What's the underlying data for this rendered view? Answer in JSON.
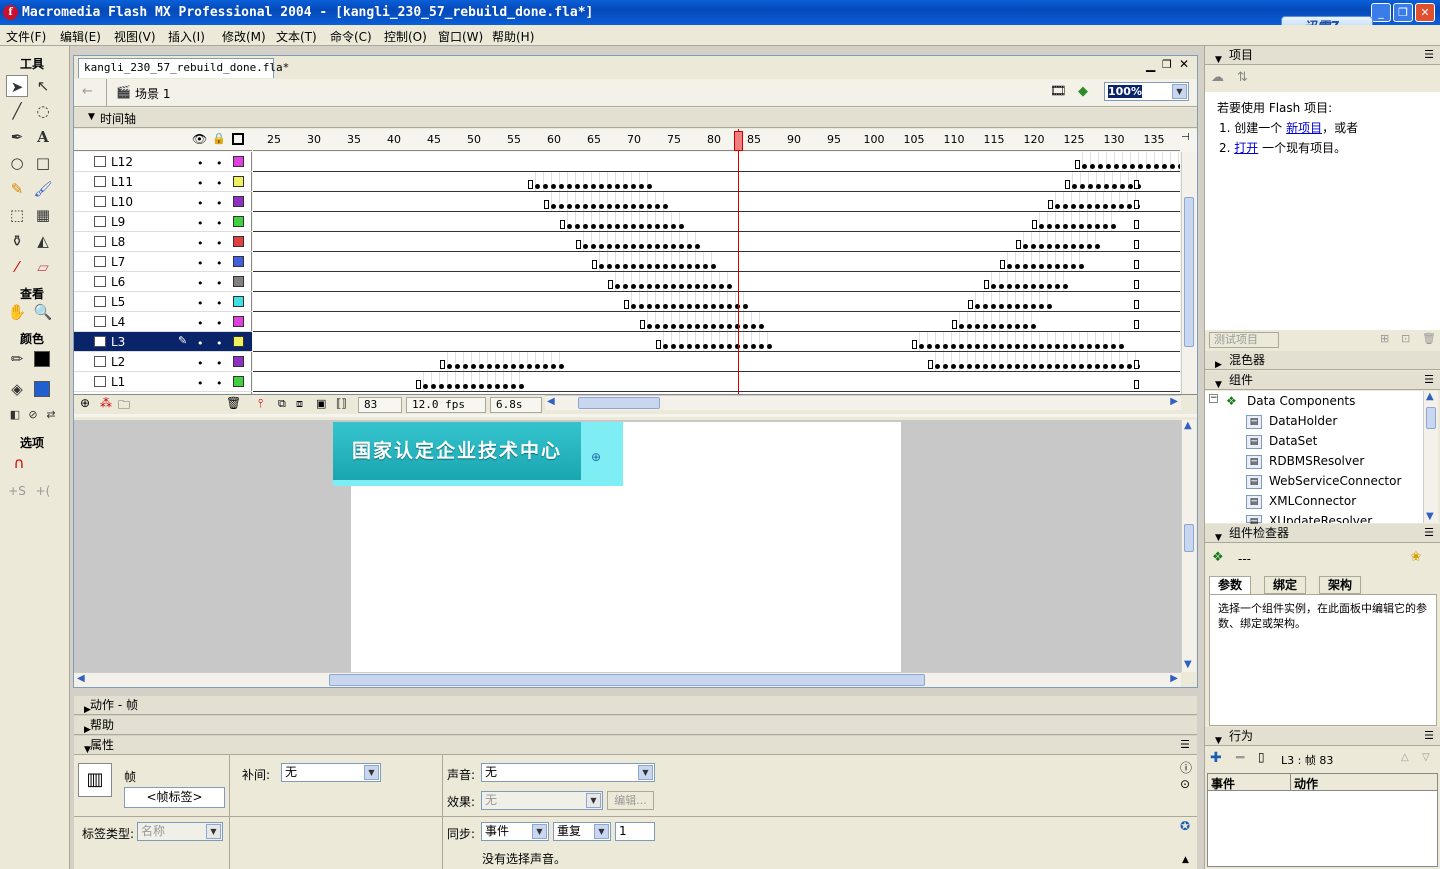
{
  "window": {
    "title": "Macromedia Flash MX Professional 2004 - [kangli_230_57_rebuild_done.fla*]",
    "app_icon_letter": "f",
    "minimize": "_",
    "maximize": "❐",
    "close": "✕"
  },
  "xunlei": {
    "label": "迅雷7"
  },
  "menu": [
    "文件(F)",
    "编辑(E)",
    "视图(V)",
    "插入(I)",
    "修改(M)",
    "文本(T)",
    "命令(C)",
    "控制(O)",
    "窗口(W)",
    "帮助(H)"
  ],
  "tools": {
    "title": "工具",
    "view": "查看",
    "colors": "颜色",
    "options": "选项"
  },
  "document": {
    "tab": "kangli_230_57_rebuild_done.fla*",
    "scene": "场景 1",
    "zoom": "100%"
  },
  "timeline": {
    "title": "时间轴",
    "ruler": [
      "25",
      "30",
      "35",
      "40",
      "45",
      "50",
      "55",
      "60",
      "65",
      "70",
      "75",
      "80",
      "85",
      "90",
      "95",
      "100",
      "105",
      "110",
      "115",
      "120",
      "125",
      "130",
      "135"
    ],
    "layers": [
      "L12",
      "L11",
      "L10",
      "L9",
      "L8",
      "L7",
      "L6",
      "L5",
      "L4",
      "L3",
      "L2",
      "L1"
    ],
    "current_frame": "83",
    "fps": "12.0 fps",
    "time": "6.8s",
    "playhead_frame": 83
  },
  "stage": {
    "banner_text": "国家认定企业技术中心"
  },
  "panels": {
    "actions": "动作 - 帧",
    "help": "帮助",
    "properties": "属性"
  },
  "props": {
    "frame_label": "帧",
    "frame_name_placeholder": "<帧标签>",
    "tween_label": "补间:",
    "tween_value": "无",
    "label_type": "标签类型:",
    "label_type_value": "名称",
    "sound_label": "声音:",
    "sound_value": "无",
    "effect_label": "效果:",
    "effect_value": "无",
    "edit_btn": "编辑...",
    "sync_label": "同步:",
    "sync_value": "事件",
    "repeat_value": "重复",
    "repeat_count": "1",
    "no_sound": "没有选择声音。"
  },
  "project": {
    "title": "项目",
    "intro": "若要使用 Flash 项目:",
    "step1_pre": "1. 创建一个 ",
    "step1_link": "新项目",
    "step1_post": "，或者",
    "step2_pre": "2. ",
    "step2_link": "打开",
    "step2_post": " 一个现有项目。",
    "test_btn": "测试项目"
  },
  "mixer": {
    "title": "混色器"
  },
  "components": {
    "title": "组件",
    "root": "Data Components",
    "items": [
      "DataHolder",
      "DataSet",
      "RDBMSResolver",
      "WebServiceConnector",
      "XMLConnector",
      "XUpdateResolver"
    ]
  },
  "inspector": {
    "title": "组件检查器",
    "selection": "---",
    "tabs": [
      "参数",
      "绑定",
      "架构"
    ],
    "message": "选择一个组件实例，在此面板中编辑它的参数、绑定或架构。"
  },
  "behaviors": {
    "title": "行为",
    "target": "L3 : 帧 83",
    "col_event": "事件",
    "col_action": "动作"
  }
}
